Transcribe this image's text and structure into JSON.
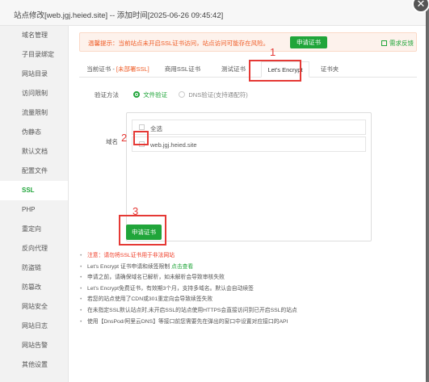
{
  "dialog": {
    "title": "站点修改[web.jgj.heied.site] -- 添加时间[2025-06-26 09:45:42]",
    "close_glyph": "✕"
  },
  "sidebar": {
    "items": [
      {
        "label": "域名管理"
      },
      {
        "label": "子目录绑定"
      },
      {
        "label": "网站目录"
      },
      {
        "label": "访问限制"
      },
      {
        "label": "流量限制"
      },
      {
        "label": "伪静态"
      },
      {
        "label": "默认文档"
      },
      {
        "label": "配置文件"
      },
      {
        "label": "SSL"
      },
      {
        "label": "PHP"
      },
      {
        "label": "重定向"
      },
      {
        "label": "反向代理"
      },
      {
        "label": "防盗链"
      },
      {
        "label": "防篡改"
      },
      {
        "label": "网站安全"
      },
      {
        "label": "网站日志"
      },
      {
        "label": "网站告警"
      },
      {
        "label": "其他设置"
      }
    ],
    "active_index": 8
  },
  "warning": {
    "text": "温馨提示：当前站点未开启SSL证书访问，站点访问可能存在风险。",
    "button_label": "申请证书",
    "feedback_label": "需求反馈"
  },
  "tabs": [
    {
      "label_prefix": "当前证书 - ",
      "label_status": "[未部署SSL]"
    },
    {
      "label": "商用SSL证书"
    },
    {
      "label": "测试证书"
    },
    {
      "label": "Let's Encrypt"
    },
    {
      "label": "证书夹"
    }
  ],
  "annotations": {
    "one": "1",
    "two": "2",
    "three": "3"
  },
  "verify": {
    "label": "验证方法",
    "option_file": "文件验证",
    "option_dns": "DNS验证(支持通配符)"
  },
  "domains": {
    "label": "域名",
    "select_all": "全选",
    "items": [
      "web.jgj.heied.site"
    ]
  },
  "apply_button": "申请证书",
  "notes": {
    "n1": "注意：请勿将SSL证书用于非法网站",
    "n2_prefix": "Let's Encrypt 证书申请和续签限制 ",
    "n2_link": "点击查看",
    "n3": "申请之前，请确保域名已解析，如未解析会导致审核失败",
    "n4": "Let's Encrypt免费证书，有效期3个月，支持多域名。默认会自动续签",
    "n5": "若您的站点使用了CDN或301重定向会导致续签失败",
    "n6": "在未指定SSL默认站点时,未开启SSL的站点使用HTTPS会直接访问到已开启SSL的站点",
    "n7": "使用【DnsPod/阿里云DNS】等接口前您需要先在弹出的窗口中设置对应接口的API"
  },
  "colors": {
    "accent_green": "#20a53a",
    "warning_orange": "#ef5b25",
    "annotation_red": "#e53935"
  }
}
